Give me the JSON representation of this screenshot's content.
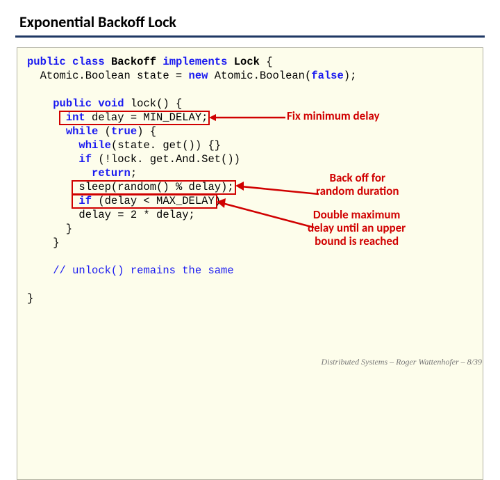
{
  "title": "Exponential Backoff Lock",
  "code": {
    "l1a": "public",
    "l1b": "class",
    "l1c": "Backoff",
    "l1d": "implements",
    "l1e": "Lock",
    "l1f": " {",
    "l2a": "  Atomic.Boolean state = ",
    "l2b": "new",
    "l2c": " Atomic.Boolean(",
    "l2d": "false",
    "l2e": ");",
    "l3a": "public",
    "l3b": "void",
    "l3c": " lock() {",
    "l4a": "int",
    "l4b": " delay = MIN_DELAY;",
    "l5a": "while",
    "l5b": " (",
    "l5c": "true",
    "l5d": ") {",
    "l6a": "while",
    "l6b": "(state. get()) {}",
    "l7a": "if",
    "l7b": " (!lock. get.And.Set())",
    "l8a": "return",
    "l8b": ";",
    "l9": "sleep(random() % delay);",
    "l10a": "if",
    "l10b": " (delay < MAX_DELAY)",
    "l11": "delay = 2 * delay;",
    "l12": "      }",
    "l13": "    }",
    "l14": "// unlock() remains the same",
    "l15": "}"
  },
  "annotations": {
    "a1": "Fix minimum delay",
    "a2": "Back off for\nrandom duration",
    "a3": "Double maximum\ndelay until an upper\nbound is reached"
  },
  "footer": "Distributed Systems  –  Roger Wattenhofer   – 8/39"
}
